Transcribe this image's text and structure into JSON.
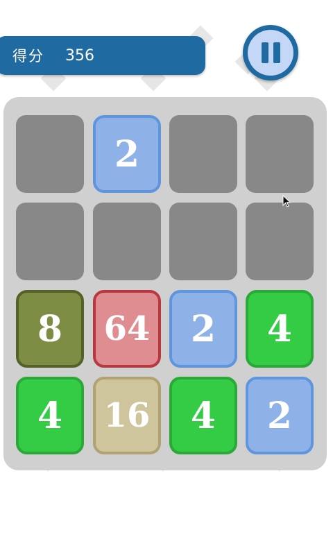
{
  "header": {
    "score_label": "得分",
    "score_value": "356"
  },
  "controls": {
    "pause_icon": "pause-icon"
  },
  "colors": {
    "header_blue": "#1f6aa0",
    "pause_inner": "#c4d7f6",
    "board_bg": "#d0d0d0",
    "empty_cell": "#888888",
    "tile_2": "#8eb2e8",
    "tile_4": "#33cc44",
    "tile_8": "#7d8e44",
    "tile_16": "#cfc59c",
    "tile_64": "#e08d92"
  },
  "board": {
    "rows": [
      [
        "",
        "2",
        "",
        ""
      ],
      [
        "",
        "",
        "",
        ""
      ],
      [
        "8",
        "64",
        "2",
        "4"
      ],
      [
        "4",
        "16",
        "4",
        "2"
      ]
    ]
  }
}
